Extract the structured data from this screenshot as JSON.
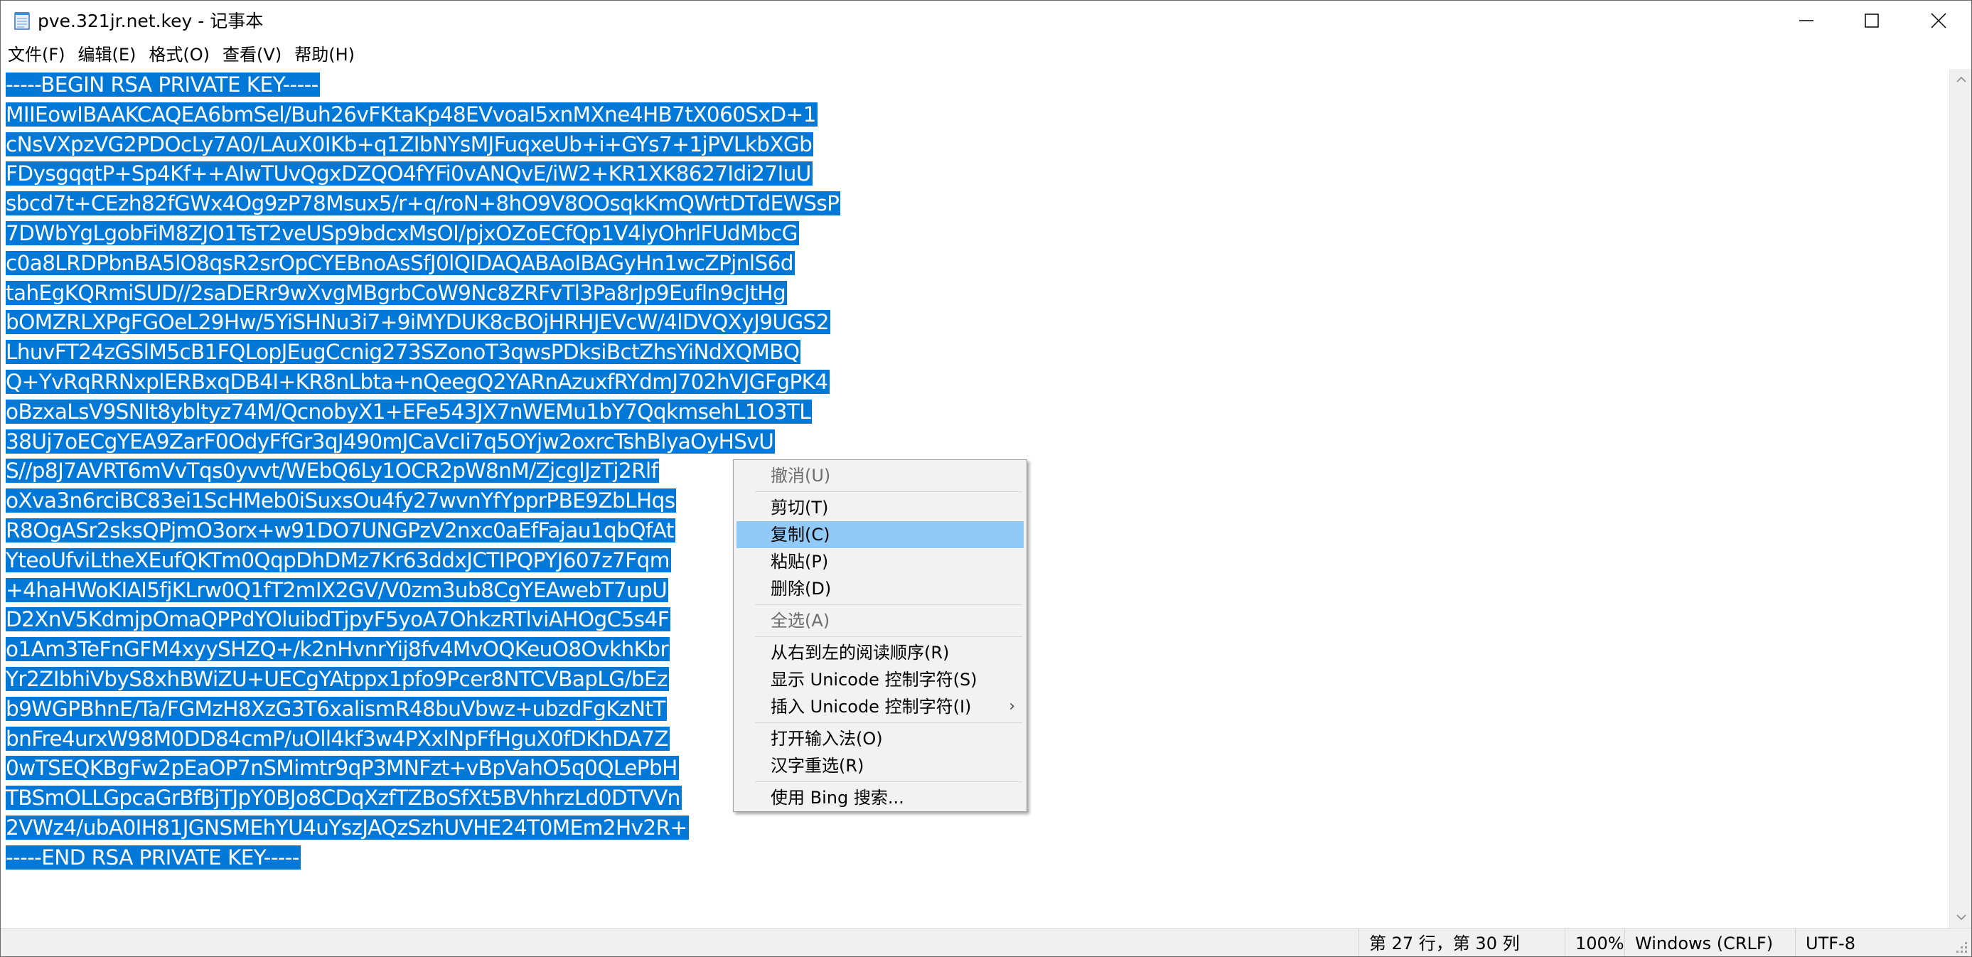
{
  "window": {
    "title": "pve.321jr.net.key - 记事本",
    "minimize_icon": "minimize-icon",
    "maximize_icon": "maximize-icon",
    "close_icon": "close-icon"
  },
  "menubar": {
    "items": [
      {
        "label": "文件(F)"
      },
      {
        "label": "编辑(E)"
      },
      {
        "label": "格式(O)"
      },
      {
        "label": "查看(V)"
      },
      {
        "label": "帮助(H)"
      }
    ]
  },
  "editor": {
    "selection_color": "#0078d7",
    "lines": [
      "-----BEGIN RSA PRIVATE KEY-----",
      "MIIEowIBAAKCAQEA6bmSel/Buh26vFKtaKp48EVvoaI5xnMXne4HB7tX060SxD+1",
      "cNsVXpzVG2PDOcLy7A0/LAuX0IKb+q1ZIbNYsMJFuqxeUb+i+GYs7+1jPVLkbXGb",
      "FDysgqqtP+Sp4Kf++AIwTUvQgxDZQO4fYFi0vANQvE/iW2+KR1XK8627Idi27IuU",
      "sbcd7t+CEzh82fGWx4Og9zP78Msux5/r+q/roN+8hO9V8OOsqkKmQWrtDTdEWSsP",
      "7DWbYgLgobFiM8ZJO1TsT2veUSp9bdcxMsOI/pjxOZoECfQp1V4lyOhrlFUdMbcG",
      "c0a8LRDPbnBA5lO8qsR2srOpCYEBnoAsSfJ0lQIDAQABAoIBAGyHn1wcZPjnlS6d",
      "tahEgKQRmiSUD//2saDERr9wXvgMBgrbCoW9Nc8ZRFvTl3Pa8rJp9Eufln9cJtHg",
      "bOMZRLXPgFGOeL29Hw/5YiSHNu3i7+9iMYDUK8cBOjHRHJEVcW/4lDVQXyJ9UGS2",
      "LhuvFT24zGSlM5cB1FQLopJEugCcnig273SZonoT3qwsPDksiBctZhsYiNdXQMBQ",
      "Q+YvRqRRNxplERBxqDB4I+KR8nLbta+nQeegQ2YARnAzuxfRYdmJ702hVJGFgPK4",
      "oBzxaLsV9SNIt8ybltyz74M/QcnobyX1+EFe543JX7nWEMu1bY7QqkmsehL1O3TL",
      "38Uj7oECgYEA9ZarF0OdyFfGr3qJ490mJCaVcIi7q5OYjw2oxrcTshBlyaOyHSvU",
      "S//p8J7AVRT6mVvTqs0yvvt/WEbQ6Ly1OCR2pW8nM/ZjcglJzTj2Rlf",
      "oXva3n6rciBC83ei1ScHMeb0iSuxsOu4fy27wvnYfYpprPBE9ZbLHqs",
      "R8OgASr2sksQPjmO3orx+w91DO7UNGPzV2nxc0aEfFajau1qbQfAt",
      "YteoUfviLtheXEufQKTm0QqpDhDMz7Kr63ddxJCTIPQPYJ607z7Fqm",
      "+4haHWoKIAI5fjKLrw0Q1fT2mIX2GV/V0zm3ub8CgYEAwebT7upU",
      "D2XnV5KdmjpOmaQPPdYOluibdTjpyF5yoA7OhkzRTlviAHOgC5s4F",
      "o1Am3TeFnGFM4xyySHZQ+/k2nHvnrYij8fv4MvOQKeuO8OvkhKbr",
      "Yr2ZIbhiVbyS8xhBWiZU+UECgYAtppx1pfo9Pcer8NTCVBapLG/bEz",
      "b9WGPBhnE/Ta/FGMzH8XzG3T6xalismR48buVbwz+ubzdFgKzNtT",
      "bnFre4urxW98M0DD84cmP/uOll4kf3w4PXxlNpFfHguX0fDKhDA7Z",
      "0wTSEQKBgFw2pEaOP7nSMimtr9qP3MNFzt+vBpVahO5q0QLePbH",
      "TBSmOLLGpcaGrBfBjTJpY0BJo8CDqXzfTZBoSfXt5BVhhrzLd0DTVVn",
      "2VWz4/ubA0IH81JGNSMEhYU4uYszJAQzSzhUVHE24T0MEm2Hv2R+",
      "-----END RSA PRIVATE KEY-----"
    ]
  },
  "context_menu": {
    "items": [
      {
        "label": "撤消(U)",
        "disabled": true
      },
      {
        "label": "剪切(T)",
        "disabled": false
      },
      {
        "label": "复制(C)",
        "disabled": false,
        "highlighted": true
      },
      {
        "label": "粘贴(P)",
        "disabled": false
      },
      {
        "label": "删除(D)",
        "disabled": false
      },
      {
        "label": "全选(A)",
        "disabled": true
      },
      {
        "label": "从右到左的阅读顺序(R)",
        "disabled": false
      },
      {
        "label": "显示 Unicode 控制字符(S)",
        "disabled": false
      },
      {
        "label": "插入 Unicode 控制字符(I)",
        "disabled": false,
        "submenu": true
      },
      {
        "label": "打开输入法(O)",
        "disabled": false
      },
      {
        "label": "汉字重选(R)",
        "disabled": false
      },
      {
        "label": "使用 Bing 搜索...",
        "disabled": false
      }
    ],
    "submenu_arrow": "›"
  },
  "statusbar": {
    "position": "第 27 行，第 30 列",
    "zoom": "100%",
    "line_ending": "Windows (CRLF)",
    "encoding": "UTF-8"
  }
}
